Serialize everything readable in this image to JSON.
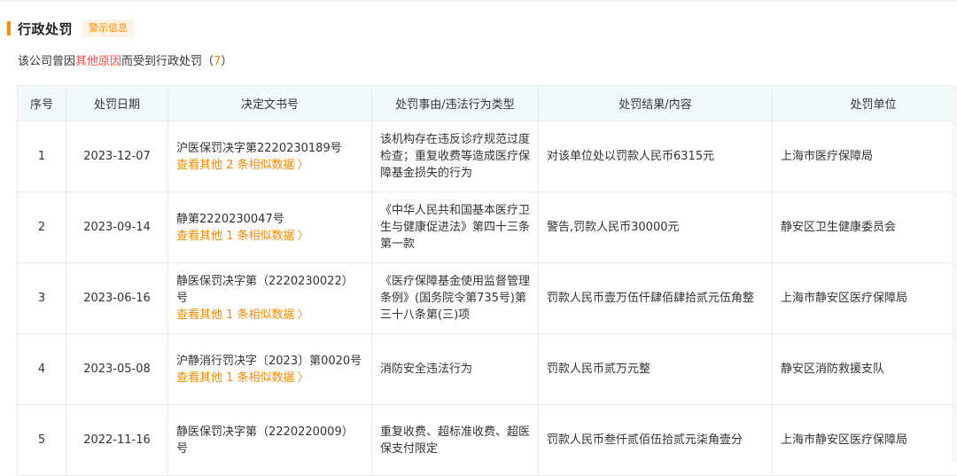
{
  "section": {
    "title": "行政处罚",
    "badge": "警示信息",
    "summary_prefix": "该公司曾因",
    "summary_highlight": "其他原因",
    "summary_mid": "而受到行政处罚（",
    "summary_count": "7",
    "summary_suffix": "）"
  },
  "table": {
    "headers": [
      "序号",
      "处罚日期",
      "决定文书号",
      "处罚事由/违法行为类型",
      "处罚结果/内容",
      "处罚单位"
    ],
    "rows": [
      {
        "no": "1",
        "date": "2023-12-07",
        "doc": "沪医保罚决字第2220230189号",
        "link": "查看其他 2 条相似数据",
        "reason": "该机构存在违反诊疗规范过度检查；重复收费等造成医疗保障基金损失的行为",
        "result": "对该单位处以罚款人民币6315元",
        "unit": "上海市医疗保障局"
      },
      {
        "no": "2",
        "date": "2023-09-14",
        "doc": "静第2220230047号",
        "link": "查看其他 1 条相似数据",
        "reason": "《中华人民共和国基本医疗卫生与健康促进法》第四十三条第一款",
        "result": "警告,罚款人民币30000元",
        "unit": "静安区卫生健康委员会"
      },
      {
        "no": "3",
        "date": "2023-06-16",
        "doc": "静医保罚决字第（2220230022）号",
        "link": "查看其他 1 条相似数据",
        "reason": "《医疗保障基金使用监督管理条例》(国务院令第735号)第三十八条第(三)项",
        "result": "罚款人民币壹万伍仟肆佰肆拾贰元伍角整",
        "unit": "上海市静安区医疗保障局"
      },
      {
        "no": "4",
        "date": "2023-05-08",
        "doc": "沪静消行罚决字〔2023〕第0020号",
        "link": "查看其他 1 条相似数据",
        "reason": "消防安全违法行为",
        "result": "罚款人民币贰万元整",
        "unit": "静安区消防救援支队"
      },
      {
        "no": "5",
        "date": "2022-11-16",
        "doc": "静医保罚决字第（2220220009）号",
        "link": "",
        "reason": "重复收费、超标准收费、超医保支付限定",
        "result": "罚款人民币叁仟贰佰伍拾贰元柒角壹分",
        "unit": "上海市静安区医疗保障局"
      }
    ]
  },
  "icons": {
    "link_chevron": "chevron-right-icon"
  },
  "colors": {
    "accent": "#fe8a00",
    "highlight": "#ff4c4c",
    "header_bg": "#f2f9fc",
    "border": "#e8eaee"
  }
}
